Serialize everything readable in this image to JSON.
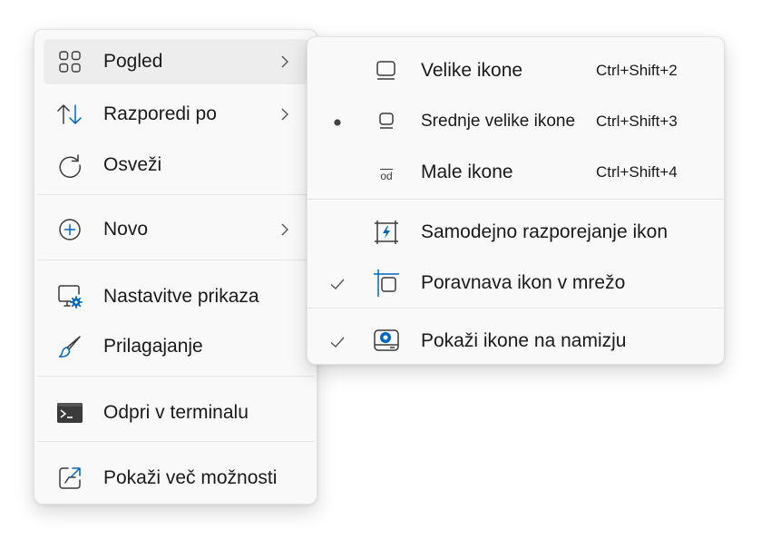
{
  "main_menu": {
    "items": [
      {
        "label": "Pogled",
        "icon": "grid-four-squares-icon",
        "has_submenu": true,
        "highlighted": true
      },
      {
        "label": "Razporedi po",
        "icon": "sort-arrows-icon",
        "has_submenu": true
      },
      {
        "label": "Osveži",
        "icon": "refresh-icon",
        "has_submenu": false
      },
      {
        "label": "Novo",
        "icon": "plus-circle-icon",
        "has_submenu": true
      },
      {
        "label": "Nastavitve prikaza",
        "icon": "display-settings-icon",
        "has_submenu": false
      },
      {
        "label": "Prilagajanje",
        "icon": "paintbrush-icon",
        "has_submenu": false
      },
      {
        "label": "Odpri v terminalu",
        "icon": "terminal-icon",
        "has_submenu": false
      },
      {
        "label": "Pokaži več možnosti",
        "icon": "open-external-icon",
        "has_submenu": false
      }
    ]
  },
  "view_submenu": {
    "items": [
      {
        "label": "Velike ikone",
        "shortcut": "Ctrl+Shift+2",
        "icon": "large-icons-icon",
        "selected": false
      },
      {
        "label": "Srednje velike ikone",
        "shortcut": "Ctrl+Shift+3",
        "icon": "medium-icons-icon",
        "selected": true
      },
      {
        "label": "Male ikone",
        "shortcut": "Ctrl+Shift+4",
        "icon": "small-icons-icon",
        "icon_text": "od",
        "selected": false
      },
      {
        "label": "Samodejno razporejanje ikon",
        "icon": "auto-arrange-icon",
        "checked": false
      },
      {
        "label": "Poravnava ikon v mrežo",
        "icon": "align-grid-icon",
        "checked": true
      },
      {
        "label": "Pokaži ikone na namizju",
        "icon": "show-desktop-icons-icon",
        "checked": true
      }
    ]
  },
  "colors": {
    "accent": "#0067c0",
    "menu_bg": "#f9f9f9",
    "hover_bg": "#ededed",
    "separator": "#e3e3e3"
  }
}
